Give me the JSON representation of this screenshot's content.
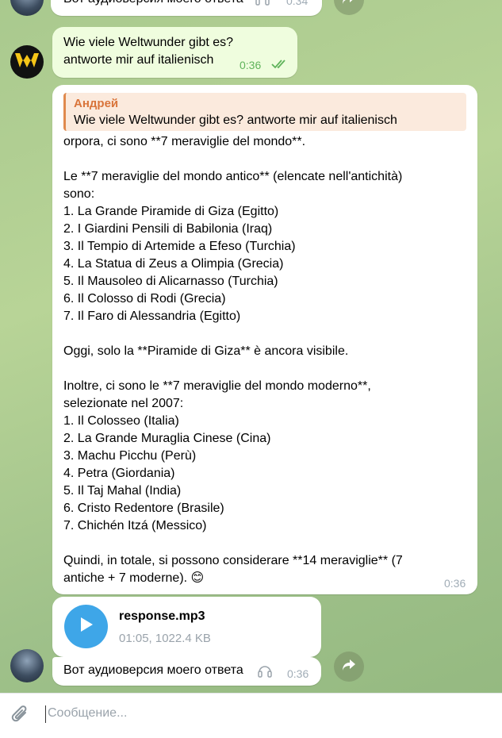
{
  "colors": {
    "accent": "#3ea6e8",
    "outgoing_bubble": "#effdde",
    "reply_author": "#d9743a",
    "read_check": "#5fb35a"
  },
  "top_message": {
    "text": "Вот аудиоверсия моего ответа",
    "time": "0:34",
    "icon": "headphones-icon"
  },
  "outgoing": {
    "text": "Wie viele Weltwunder gibt es?\nantworte mir auf italienisch",
    "time": "0:36",
    "status_icon": "double-check-icon"
  },
  "reply": {
    "author": "Андрей",
    "quoted": "Wie viele Weltwunder gibt es? antworte mir auf italienisch",
    "body": "orpora, ci sono **7 meraviglie del mondo**.\n\nLe **7 meraviglie del mondo antico** (elencate nell'antichità)\nsono:\n1. La Grande Piramide di Giza (Egitto)\n2. I Giardini Pensili di Babilonia (Iraq)\n3. Il Tempio di Artemide a Efeso (Turchia)\n4. La Statua di Zeus a Olimpia (Grecia)\n5. Il Mausoleo di Alicarnasso (Turchia)\n6. Il Colosso di Rodi (Grecia)\n7. Il Faro di Alessandria (Egitto)\n\nOggi, solo la **Piramide di Giza** è ancora visibile.\n\nInoltre, ci sono le **7 meraviglie del mondo moderno**,\nselezionate nel 2007:\n1. Il Colosseo (Italia)\n2. La Grande Muraglia Cinese (Cina)\n3. Machu Picchu (Perù)\n4. Petra (Giordania)\n5. Il Taj Mahal (India)\n6. Cristo Redentore (Brasile)\n7. Chichén Itzá (Messico)\n\nQuindi, in totale, si possono considerare **14 meraviglie** (7\nantiche + 7 moderne). 😊",
    "time": "0:36"
  },
  "audio": {
    "filename": "response.mp3",
    "meta": "01:05, 1022.4 KB"
  },
  "bottom_message": {
    "text": "Вот аудиоверсия моего ответа",
    "time": "0:36",
    "icon": "headphones-icon"
  },
  "input": {
    "placeholder": "Сообщение..."
  }
}
